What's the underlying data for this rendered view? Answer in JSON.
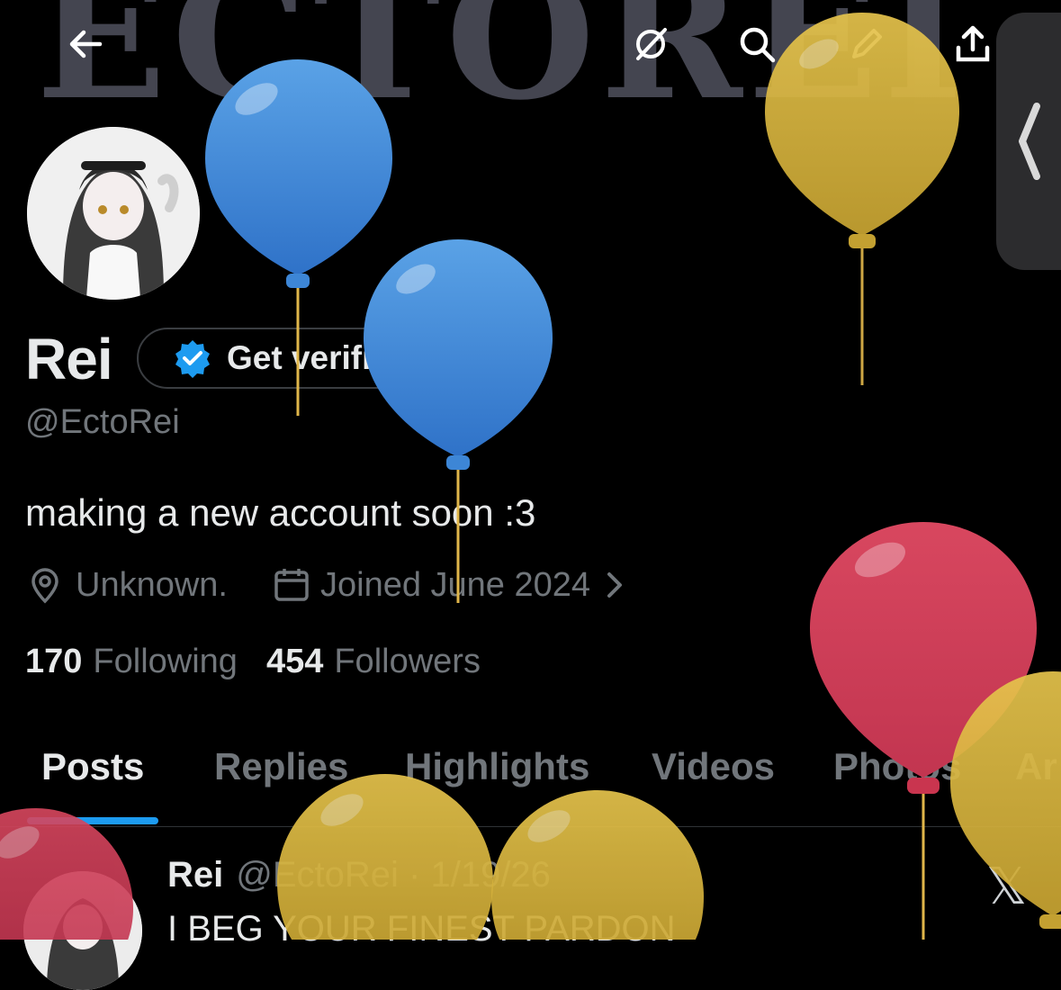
{
  "banner": {
    "text": "ECTOREI"
  },
  "top_icons": [
    "back-arrow-icon",
    "grok-icon",
    "search-icon",
    "edit-icon",
    "share-icon"
  ],
  "profile": {
    "name": "Rei",
    "verify_label": "Get verified",
    "handle": "@EctoRei",
    "bio": "making a new account soon :3",
    "location": "Unknown.",
    "joined": "Joined June 2024",
    "following_count": "170",
    "following_label": "Following",
    "followers_count": "454",
    "followers_label": "Followers"
  },
  "tabs": [
    {
      "label": "Posts",
      "active": true
    },
    {
      "label": "Replies"
    },
    {
      "label": "Highlights"
    },
    {
      "label": "Videos"
    },
    {
      "label": "Photos"
    },
    {
      "label": "Ar"
    }
  ],
  "post": {
    "name": "Rei",
    "handle_date": "@EctoRei · 1/19/26",
    "text": "I BEG YOUR FINEST PARDON"
  },
  "colors": {
    "accent": "#1d9bf0",
    "balloon_blue": "#3f86d6",
    "balloon_yellow": "#dcb73e",
    "balloon_red": "#cf3b57"
  }
}
